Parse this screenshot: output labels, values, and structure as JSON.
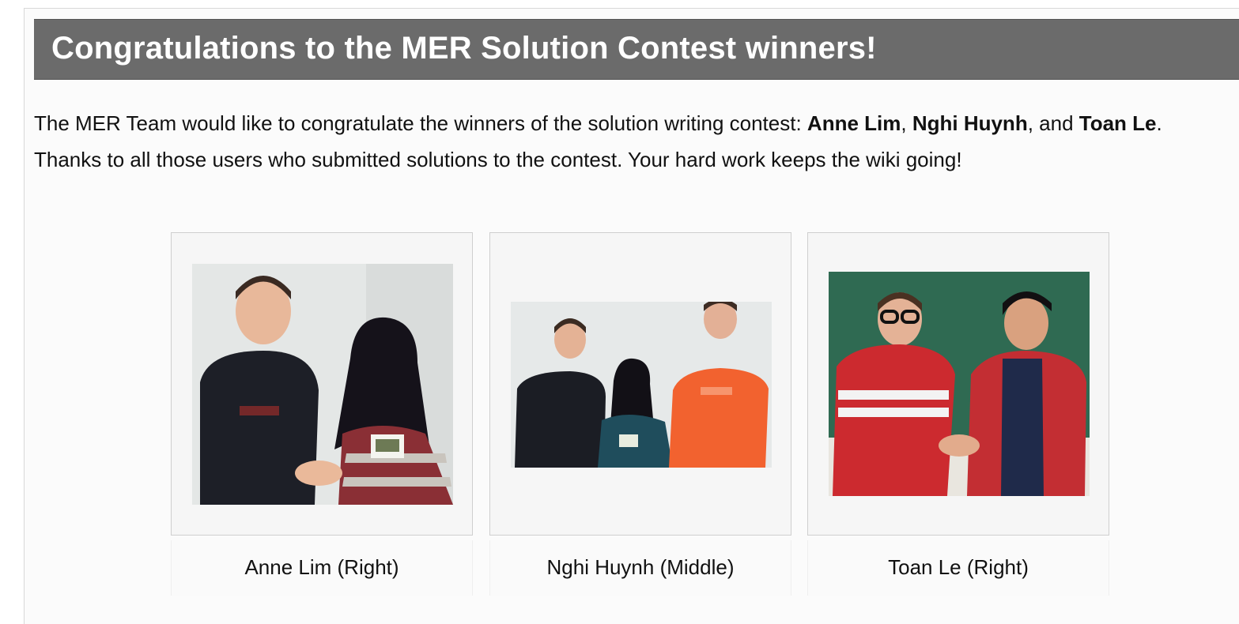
{
  "banner": {
    "title": "Congratulations to the MER Solution Contest winners!"
  },
  "intro": {
    "text_1": "The MER Team would like to congratulate the winners of the solution writing contest: ",
    "winner_1": "Anne Lim",
    "sep_1": ", ",
    "winner_2": "Nghi Huynh",
    "sep_2": ", and ",
    "winner_3": "Toan Le",
    "text_2": ". Thanks to all those users who submitted solutions to the contest. Your hard work keeps the wiki going!"
  },
  "gallery": {
    "items": [
      {
        "caption": "Anne Lim (Right)"
      },
      {
        "caption": "Nghi Huynh (Middle)"
      },
      {
        "caption": "Toan Le (Right)"
      }
    ]
  },
  "colors": {
    "banner_bg": "#6b6b6b",
    "banner_text": "#ffffff",
    "card_bg": "#f6f6f6",
    "card_border": "#cfcfcf"
  }
}
